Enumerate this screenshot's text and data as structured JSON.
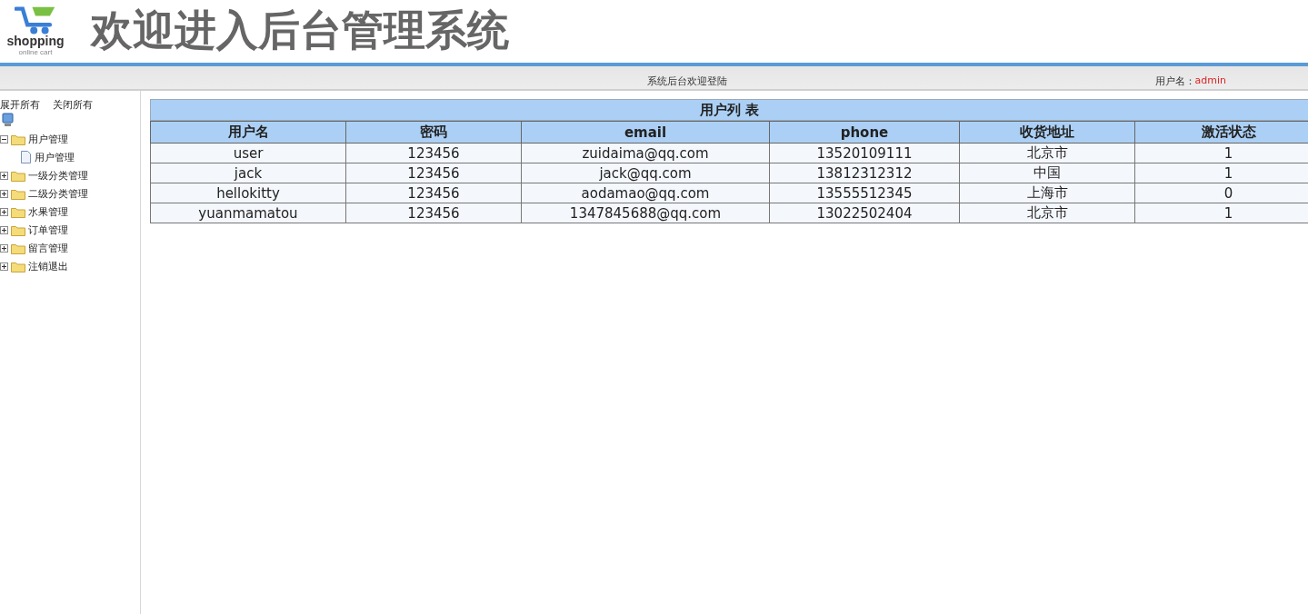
{
  "header": {
    "logo_text": "shopping",
    "logo_subtext": "online cart",
    "title": "欢迎进入后台管理系统"
  },
  "status_bar": {
    "message": "系统后台欢迎登陆",
    "user_label": "用户名：",
    "user_name": "admin"
  },
  "sidebar": {
    "expand_all": "展开所有",
    "collapse_all": "关闭所有",
    "tree": [
      {
        "label": "用户管理",
        "expanded": true,
        "children": [
          {
            "label": "用户管理"
          }
        ]
      },
      {
        "label": "一级分类管理",
        "expanded": false
      },
      {
        "label": "二级分类管理",
        "expanded": false
      },
      {
        "label": "水果管理",
        "expanded": false
      },
      {
        "label": "订单管理",
        "expanded": false
      },
      {
        "label": "留言管理",
        "expanded": false
      },
      {
        "label": "注销退出",
        "expanded": false
      }
    ]
  },
  "table": {
    "title": "用户列 表",
    "columns": [
      "用户名",
      "密码",
      "email",
      "phone",
      "收货地址",
      "激活状态"
    ],
    "rows": [
      [
        "user",
        "123456",
        "zuidaima@qq.com",
        "13520109111",
        "北京市",
        "1"
      ],
      [
        "jack",
        "123456",
        "jack@qq.com",
        "13812312312",
        "中国",
        "1"
      ],
      [
        "hellokitty",
        "123456",
        "aodamao@qq.com",
        "13555512345",
        "上海市",
        "0"
      ],
      [
        "yuanmamatou",
        "123456",
        "1347845688@qq.com",
        "13022502404",
        "北京市",
        "1"
      ]
    ]
  }
}
